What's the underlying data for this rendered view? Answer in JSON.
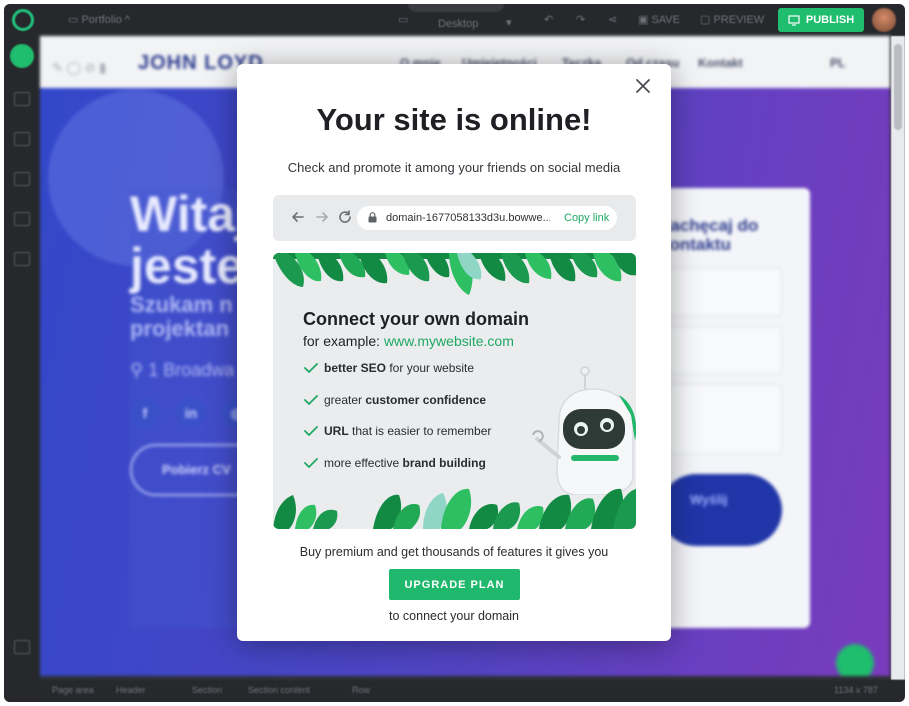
{
  "editor": {
    "project_name": "Portfolio",
    "device": "Desktop",
    "save_label": "SAVE",
    "preview_label": "PREVIEW",
    "publish_label": "PUBLISH",
    "size_readout": "1134 x 787",
    "breadcrumbs": [
      "Page area",
      "Header",
      "Section",
      "Section content",
      "Row"
    ]
  },
  "site": {
    "brand": "JOHN LOYD",
    "nav": [
      "O mnie",
      "Umiejętności",
      "Teczka",
      "Od czasu",
      "Kontakt"
    ],
    "lang": "PL",
    "hero_title_line1": "Witaj,",
    "hero_title_line2": "jestem",
    "hero_sub_line1": "Szukam n",
    "hero_sub_line2": "projektan",
    "address": "1 Broadwa",
    "cv_button": "Pobierz CV",
    "contact_title_line1": "Zachęcaj do",
    "contact_title_line2": "kontaktu",
    "send_button": "Wyślij"
  },
  "modal": {
    "title": "Your site is online!",
    "subtitle": "Check and promote it among your friends on social media",
    "url": "domain-1677058133d3u.bowwe...",
    "copy_link": "Copy link",
    "promo_title": "Connect your own domain",
    "promo_example_prefix": "for example: ",
    "promo_example_link": "www.mywebsite.com",
    "features": [
      {
        "bold": "better SEO",
        "rest": " for your website",
        "bold_first": true
      },
      {
        "pre": "greater ",
        "bold": "customer confidence",
        "bold_first": false
      },
      {
        "bold": "URL",
        "rest": " that is easier to remember",
        "bold_first": true
      },
      {
        "pre": "more effective ",
        "bold": "brand building",
        "bold_first": false
      }
    ],
    "premium_text": "Buy premium and get thousands of features it gives you",
    "upgrade_label": "UPGRADE PLAN",
    "connect_text": "to connect your domain"
  },
  "colors": {
    "accent": "#1fb86d",
    "hero_gradient_start": "#3248c9",
    "hero_gradient_end": "#7a3bbd",
    "editor_dark": "#26282c"
  },
  "icons": {
    "close": "close-icon",
    "back": "arrow-left-icon",
    "forward": "arrow-right-icon",
    "reload": "reload-icon",
    "lock": "lock-icon",
    "check": "check-icon"
  }
}
